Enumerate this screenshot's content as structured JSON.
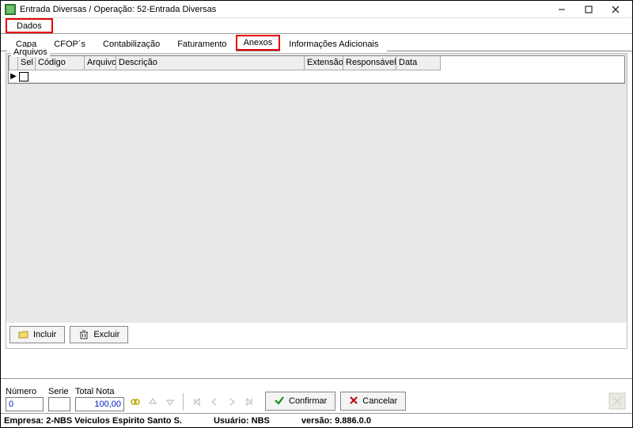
{
  "title": "Entrada Diversas / Operação: 52-Entrada Diversas",
  "menubar": {
    "dados": "Dados"
  },
  "tabs": {
    "capa": "Capa",
    "cfops": "CFOP´s",
    "contab": "Contabilização",
    "fatur": "Faturamento",
    "anexos": "Anexos",
    "infoadd": "Informações Adicionais"
  },
  "group": {
    "legend": "Arquivos"
  },
  "grid": {
    "headers": {
      "sel": "Sel",
      "codigo": "Código",
      "arquivo": "Arquivo",
      "descricao": "Descrição",
      "extensao": "Extensão",
      "responsavel": "Responsável",
      "data": "Data"
    }
  },
  "buttons": {
    "incluir": "Incluir",
    "excluir": "Excluir",
    "confirmar": "Confirmar",
    "cancelar": "Cancelar"
  },
  "footer": {
    "numero_label": "Número",
    "numero_value": "0",
    "serie_label": "Serie",
    "serie_value": "",
    "total_label": "Total Nota",
    "total_value": "100,00"
  },
  "status": {
    "empresa_label": "Empresa:",
    "empresa_value": "2-NBS Veiculos Espirito Santo S.",
    "usuario_label": "Usuário:",
    "usuario_value": "NBS",
    "versao_label": "versão:",
    "versao_value": "9.886.0.0"
  }
}
